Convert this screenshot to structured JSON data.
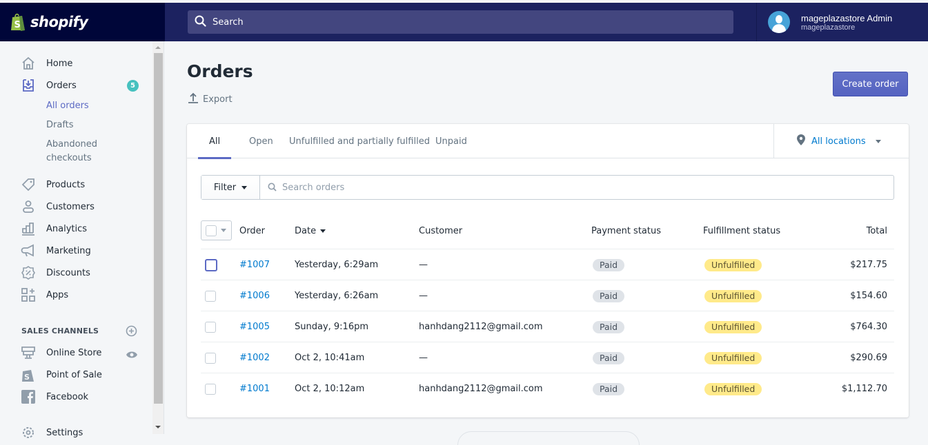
{
  "brand": {
    "name": "shopify"
  },
  "topbar": {
    "search_placeholder": "Search",
    "user": {
      "name": "mageplazastore Admin",
      "store": "mageplazastore"
    }
  },
  "sidebar": {
    "items": [
      {
        "label": "Home",
        "icon": "home-icon"
      },
      {
        "label": "Orders",
        "icon": "orders-icon",
        "badge": "5"
      },
      {
        "label": "Products",
        "icon": "tag-icon"
      },
      {
        "label": "Customers",
        "icon": "customer-icon"
      },
      {
        "label": "Analytics",
        "icon": "bar-chart-icon"
      },
      {
        "label": "Marketing",
        "icon": "megaphone-icon"
      },
      {
        "label": "Discounts",
        "icon": "discount-icon"
      },
      {
        "label": "Apps",
        "icon": "apps-icon"
      }
    ],
    "orders_sub": [
      {
        "label": "All orders",
        "active": true
      },
      {
        "label": "Drafts"
      },
      {
        "label": "Abandoned checkouts"
      }
    ],
    "sales_channels": {
      "header": "SALES CHANNELS",
      "items": [
        {
          "label": "Online Store",
          "icon": "store-icon"
        },
        {
          "label": "Point of Sale",
          "icon": "pos-bag-icon"
        },
        {
          "label": "Facebook",
          "icon": "facebook-icon"
        }
      ]
    },
    "settings_label": "Settings"
  },
  "page": {
    "title": "Orders",
    "export_label": "Export",
    "create_button": "Create order"
  },
  "tabs": [
    {
      "label": "All",
      "active": true
    },
    {
      "label": "Open"
    },
    {
      "label": "Unfulfilled and partially fulfilled"
    },
    {
      "label": "Unpaid"
    }
  ],
  "location_selector": {
    "label": "All locations"
  },
  "filter": {
    "button": "Filter",
    "search_placeholder": "Search orders",
    "search_value": ""
  },
  "table": {
    "columns": [
      "Order",
      "Date",
      "Customer",
      "Payment status",
      "Fulfillment status",
      "Total"
    ],
    "rows": [
      {
        "order": "#1007",
        "date": "Yesterday, 6:29am",
        "customer": "—",
        "payment": "Paid",
        "fulfillment": "Unfulfilled",
        "total": "$217.75"
      },
      {
        "order": "#1006",
        "date": "Yesterday, 6:26am",
        "customer": "—",
        "payment": "Paid",
        "fulfillment": "Unfulfilled",
        "total": "$154.60"
      },
      {
        "order": "#1005",
        "date": "Sunday, 9:16pm",
        "customer": "hanhdang2112@gmail.com",
        "payment": "Paid",
        "fulfillment": "Unfulfilled",
        "total": "$764.30"
      },
      {
        "order": "#1002",
        "date": "Oct 2, 10:41am",
        "customer": "—",
        "payment": "Paid",
        "fulfillment": "Unfulfilled",
        "total": "$290.69"
      },
      {
        "order": "#1001",
        "date": "Oct 2, 10:12am",
        "customer": "hanhdang2112@gmail.com",
        "payment": "Paid",
        "fulfillment": "Unfulfilled",
        "total": "$1,112.70"
      }
    ]
  },
  "colors": {
    "topbar": "#1c2260",
    "logo_bg": "#000639",
    "accent": "#5c6ac4",
    "link": "#007ace",
    "badge_teal": "#47c1bf",
    "paid_pill": "#dfe3e8",
    "unfulfilled_pill": "#ffea8a"
  }
}
